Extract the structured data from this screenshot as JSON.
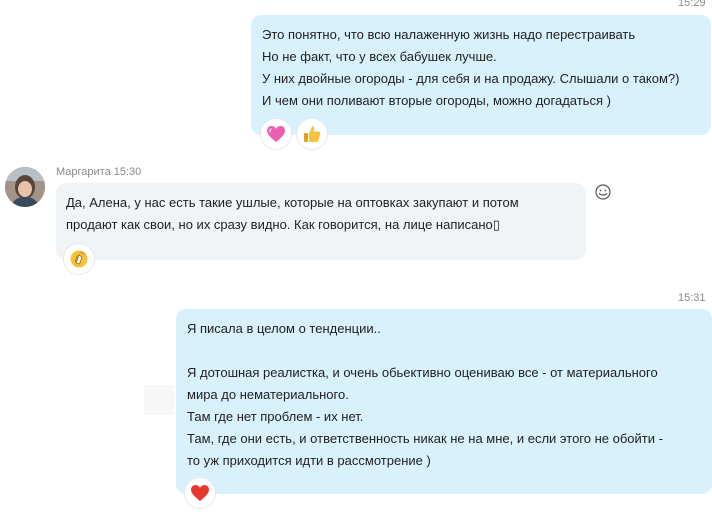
{
  "messages": [
    {
      "time": "15:29",
      "lines": [
        "Это понятно, что всю налаженную жизнь надо перестраивать",
        "Но не факт,  что у всех бабушек лучше.",
        "У них двойные огороды - для себя и на продажу. Слышали о таком?)",
        "И чем они поливают вторые огороды, можно догадаться )"
      ],
      "reactions": [
        "heart-pink-icon",
        "thumbs-up-icon"
      ]
    },
    {
      "sender": "Маргарита",
      "time": "15:30",
      "sender_line": "Маргарита 15:30",
      "lines": [
        "Да, Алена, у нас есть такие ушлые, которые на оптовках закупают и потом",
        "продают как свои, но их сразу видно. Как говорится, на лице написано▯"
      ],
      "reactions": [
        "clapping-icon"
      ]
    },
    {
      "time": "15:31",
      "lines": [
        "Я писала в целом о тенденции..",
        "",
        "Я дотошная реалистка, и очень обьективно оцениваю все - от материального",
        "мира до нематериального.",
        "Там где нет проблем - их нет.",
        "Там, где они есть, и ответственность никак не на мне, и если этого не обойти -",
        "то уж приходится идти в рассмотрение )"
      ],
      "reactions": [
        "heart-red-icon"
      ]
    }
  ],
  "colors": {
    "outgoing_bubble": "#d9f1fd",
    "incoming_bubble": "#f1f4f7",
    "timestamp": "#8a8a8a"
  }
}
